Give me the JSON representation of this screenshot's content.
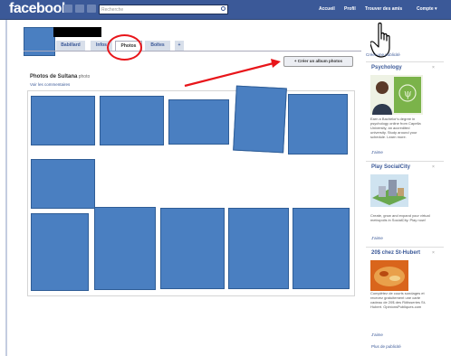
{
  "topbar": {
    "logo": "facebook",
    "search_placeholder": "Recherche",
    "nav": [
      "Accueil",
      "Profil",
      "Trouver des amis",
      "Compte ▾"
    ]
  },
  "profile": {
    "tabs": [
      "Babillard",
      "Infos",
      "Photos",
      "Boîtes",
      "+"
    ]
  },
  "album": {
    "create_button": "+  Créer un album photos",
    "title": "Photos de Sultana",
    "title_suffix": " photo",
    "comments_link": "Voir les commentaires"
  },
  "sidebar": {
    "create_ad": "Créer une publicité",
    "ads": [
      {
        "title": "Psychology",
        "text": "Earn a Bachelor's degree in psychology online from Capella University, an accredited university. Study around your schedule. Learn more.",
        "like": "J'aime"
      },
      {
        "title": "Play SocialCity",
        "text": "Create, grow and expand your virtual metropolis in SocialCity. Play now!",
        "like": "J'aime"
      },
      {
        "title": "20$ chez St-Hubert",
        "text": "Complétez de courts sondages et recevez gratuitement une carte cadeau de 20$ des Rôtisseries St-Hubert. OpinionsPubliques.com",
        "like": "J'aime"
      }
    ],
    "more_ads": "Plus de publicité"
  },
  "colors": {
    "brand": "#3b5998",
    "photo_placeholder": "#4a7fc1",
    "annotation": "#e8151a"
  },
  "icons": {
    "cursor": "hand-pointer-icon",
    "arrow": "red-arrow-annotation"
  }
}
